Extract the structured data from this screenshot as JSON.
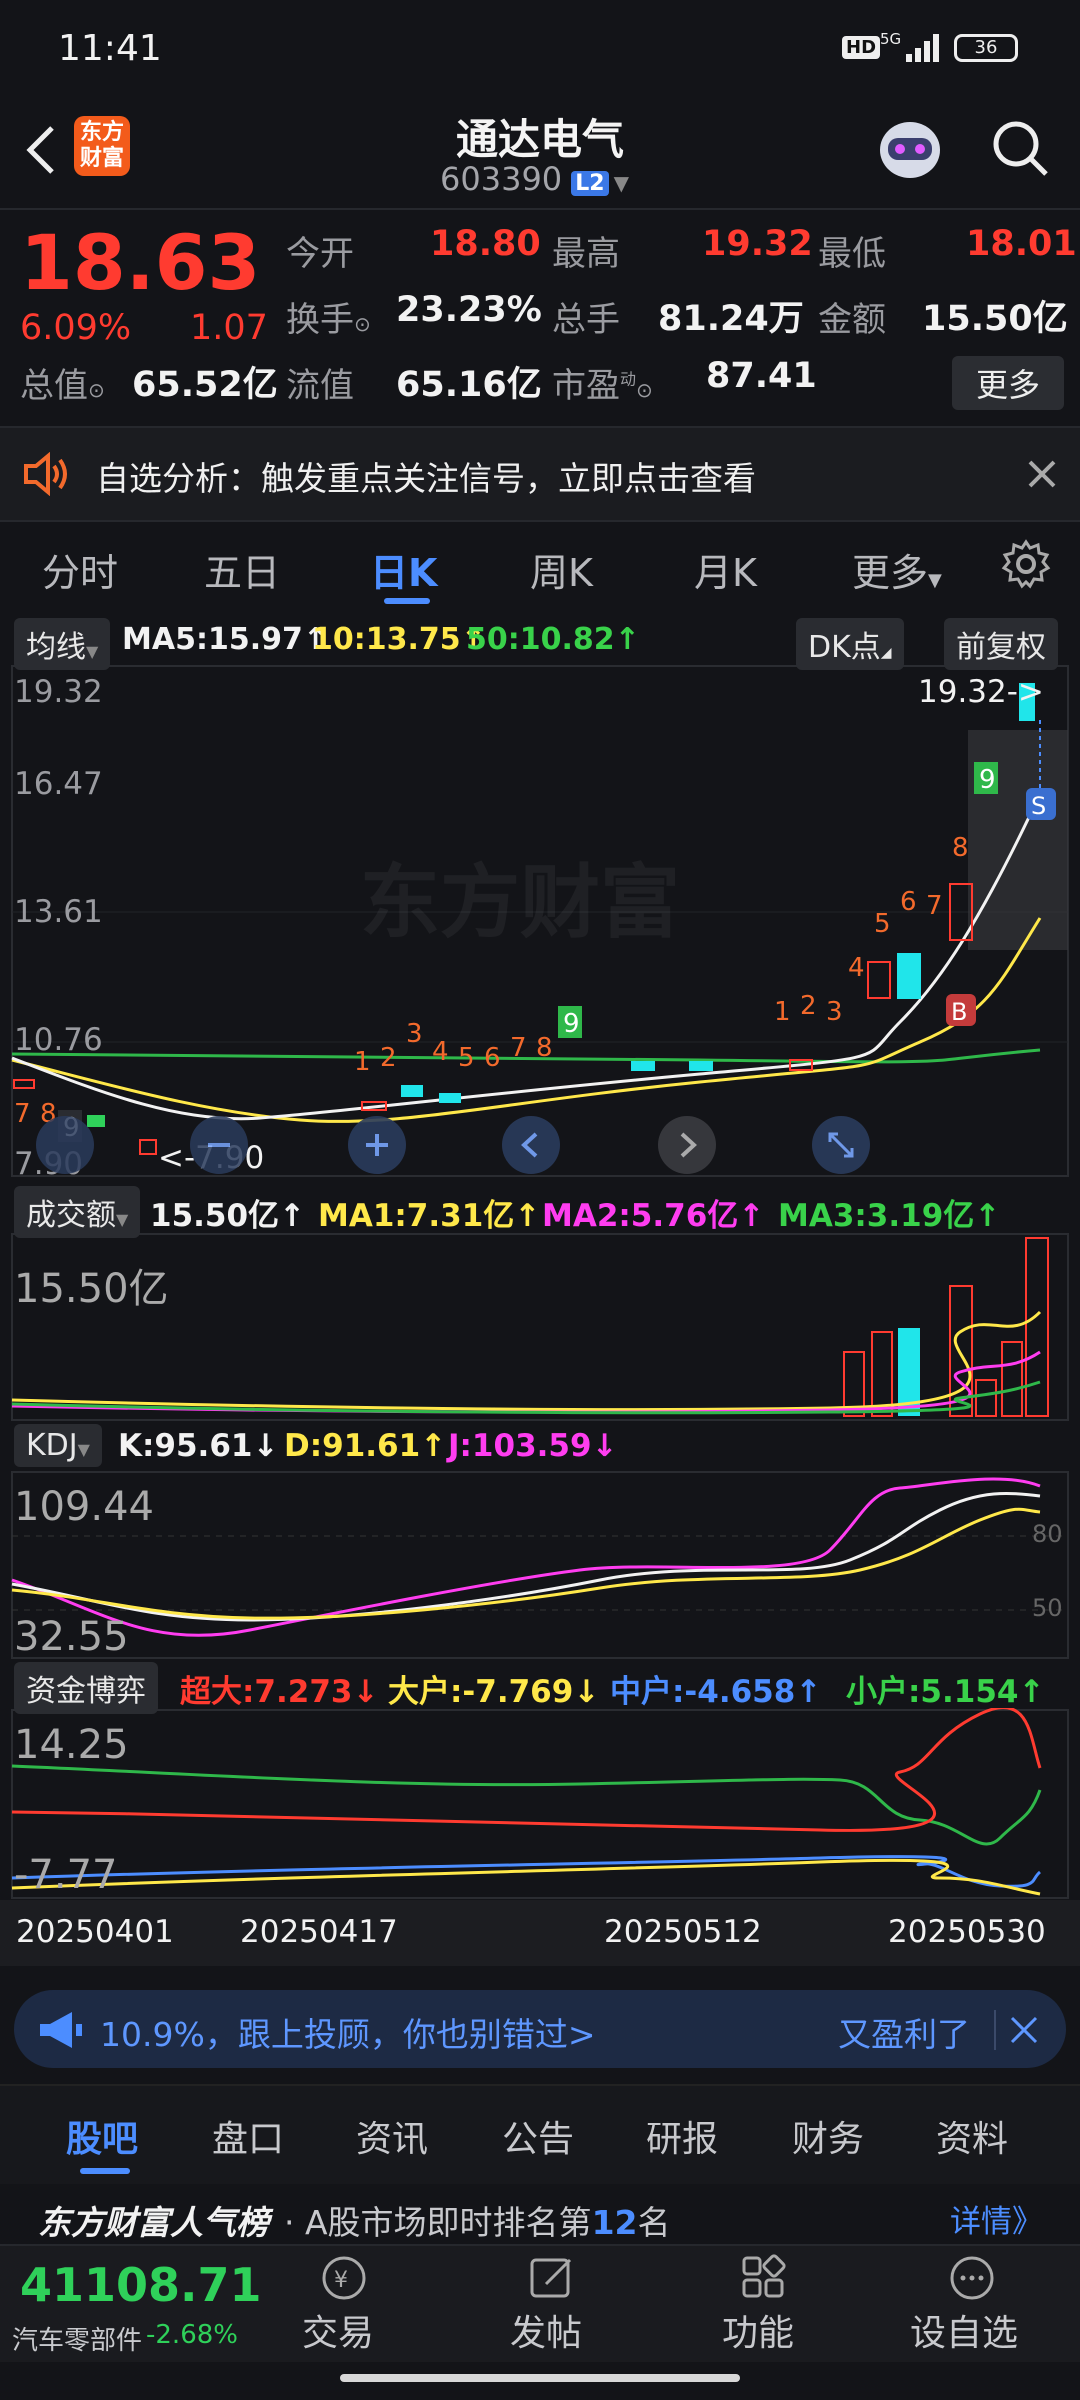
{
  "status_bar": {
    "time": "11:41",
    "hd": "HD",
    "signal": "5G",
    "battery": "36"
  },
  "header": {
    "title": "通达电气",
    "code": "603390",
    "level": "L2",
    "logo_text": "东方财富"
  },
  "quote": {
    "price": "18.63",
    "change_pct": "6.09%",
    "change": "1.07",
    "fields": [
      {
        "label": "今开",
        "value": "18.80",
        "color": "#ff3b30"
      },
      {
        "label": "最高",
        "value": "19.32",
        "color": "#ff3b30"
      },
      {
        "label": "最低",
        "value": "18.01",
        "color": "#ff3b30"
      },
      {
        "label": "换手",
        "value": "23.23%",
        "color": "#f2f2f2"
      },
      {
        "label": "总手",
        "value": "81.24万",
        "color": "#f2f2f2"
      },
      {
        "label": "金额",
        "value": "15.50亿",
        "color": "#f2f2f2"
      },
      {
        "label": "总值",
        "value": "65.52亿",
        "color": "#f2f2f2"
      },
      {
        "label": "流值",
        "value": "65.16亿",
        "color": "#f2f2f2"
      },
      {
        "label": "市盈",
        "value": "87.41",
        "color": "#f2f2f2"
      }
    ],
    "pe_sup": "动",
    "more": "更多"
  },
  "alert": {
    "text": "自选分析：触发重点关注信号，立即点击查看"
  },
  "chart_tabs": [
    "分时",
    "五日",
    "日K",
    "周K",
    "月K",
    "更多"
  ],
  "ma_bar": {
    "selector": "均线",
    "ma5": "MA5:15.97↑",
    "ma10": "10:13.75↑",
    "ma50": "50:10.82↑",
    "dk": "DK点",
    "adjust": "前复权"
  },
  "kline": {
    "y_labels": [
      "19.32",
      "16.47",
      "13.61",
      "10.76",
      "7.90"
    ],
    "high_marker": "19.32->",
    "low_marker": "<-7.90",
    "watermark": "东方财富"
  },
  "volume": {
    "selector": "成交额",
    "val": "15.50亿↑",
    "ma1": "MA1:7.31亿↑",
    "ma2": "MA2:5.76亿↑",
    "ma3": "MA3:3.19亿↑",
    "top": "15.50亿"
  },
  "kdj": {
    "selector": "KDJ",
    "k": "K:95.61↓",
    "d": "D:91.61↑",
    "j": "J:103.59↓",
    "top": "109.44",
    "bottom": "32.55",
    "l80": "80",
    "l50": "50"
  },
  "fund": {
    "selector": "资金博弈",
    "big": "超大:7.273↓",
    "large": "大户:-7.769↓",
    "mid": "中户:-4.658↑",
    "small": "小户:5.154↑",
    "top": "14.25",
    "bottom": "-7.77"
  },
  "dates": [
    "20250401",
    "20250417",
    "20250512",
    "20250530"
  ],
  "banner": {
    "text": "10.9%，跟上投顾，你也别错过>",
    "brand": "又盈利了"
  },
  "bottom_tabs": [
    "股吧",
    "盘口",
    "资讯",
    "公告",
    "研报",
    "财务",
    "资料"
  ],
  "popularity": {
    "title": "东方财富人气榜",
    "text": "· A股市场即时排名第",
    "rank": "12",
    "suffix": "名",
    "more": "详情》"
  },
  "footer": {
    "index_value": "41108.71",
    "index_name": "汽车零部件",
    "index_change": "-2.68%",
    "actions": [
      {
        "label": "交易"
      },
      {
        "label": "发帖"
      },
      {
        "label": "功能"
      },
      {
        "label": "设自选"
      }
    ]
  },
  "colors": {
    "up": "#ff3b30",
    "down": "#2fd15a",
    "accent": "#4c8dff",
    "bg": "#131418"
  }
}
